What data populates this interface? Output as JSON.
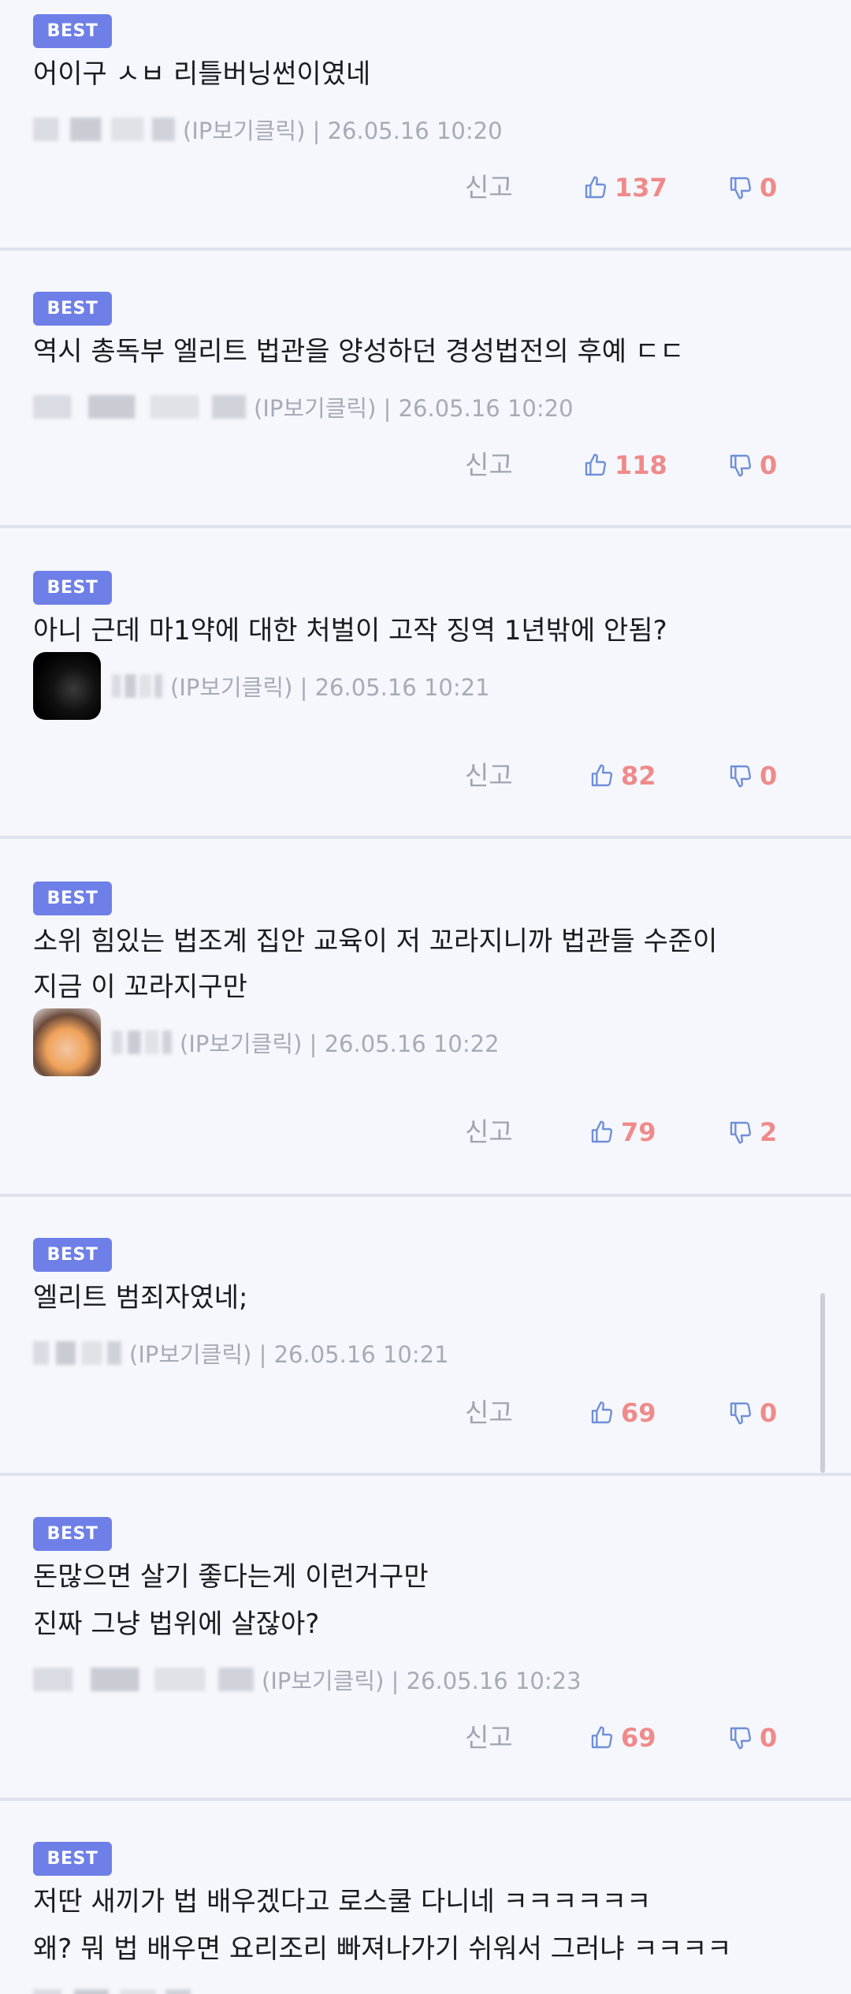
{
  "comments": [
    {
      "badge": "BEST",
      "lines": [
        "어이구 ㅅㅂ 리틀버닝썬이였네"
      ],
      "meta": "(IP보기클릭) | 26.05.16 10:20",
      "report": "신고",
      "likes": "137",
      "dislikes": "0"
    },
    {
      "badge": "BEST",
      "lines": [
        "역시 총독부 엘리트 법관을 양성하던 경성법전의 후예 ㄷㄷ"
      ],
      "meta": "(IP보기클릭) | 26.05.16 10:20",
      "report": "신고",
      "likes": "118",
      "dislikes": "0"
    },
    {
      "badge": "BEST",
      "lines": [
        "아니 근데 마1약에 대한 처벌이 고작 징역 1년밖에 안됨?"
      ],
      "meta": "(IP보기클릭) | 26.05.16 10:21",
      "report": "신고",
      "likes": "82",
      "dislikes": "0"
    },
    {
      "badge": "BEST",
      "lines": [
        "소위 힘있는 법조계 집안 교육이 저 꼬라지니까 법관들 수준이",
        "지금 이 꼬라지구만"
      ],
      "meta": "(IP보기클릭) | 26.05.16 10:22",
      "report": "신고",
      "likes": "79",
      "dislikes": "2"
    },
    {
      "badge": "BEST",
      "lines": [
        "엘리트 범죄자였네;"
      ],
      "meta": "(IP보기클릭) | 26.05.16 10:21",
      "report": "신고",
      "likes": "69",
      "dislikes": "0"
    },
    {
      "badge": "BEST",
      "lines": [
        "돈많으면 살기 좋다는게 이런거구만",
        "진짜 그냥 법위에 살잖아?"
      ],
      "meta": "(IP보기클릭) | 26.05.16 10:23",
      "report": "신고",
      "likes": "69",
      "dislikes": "0"
    },
    {
      "badge": "BEST",
      "lines": [
        "저딴 새끼가 법 배우겠다고 로스쿨 다니네 ㅋㅋㅋㅋㅋㅋ",
        "왜? 뭐 법 배우면 요리조리 빠져나가기 쉬워서 그러냐 ㅋㅋㅋㅋ"
      ],
      "meta": "",
      "report": "",
      "likes": "",
      "dislikes": ""
    }
  ],
  "colors": {
    "badge": "#6e7fe8",
    "count": "#f08a8a",
    "thumb_outline": "#6f8fd8",
    "background": "#f5f7fc"
  },
  "icons": {
    "like": "thumbs-up-icon",
    "dislike": "thumbs-down-icon"
  }
}
